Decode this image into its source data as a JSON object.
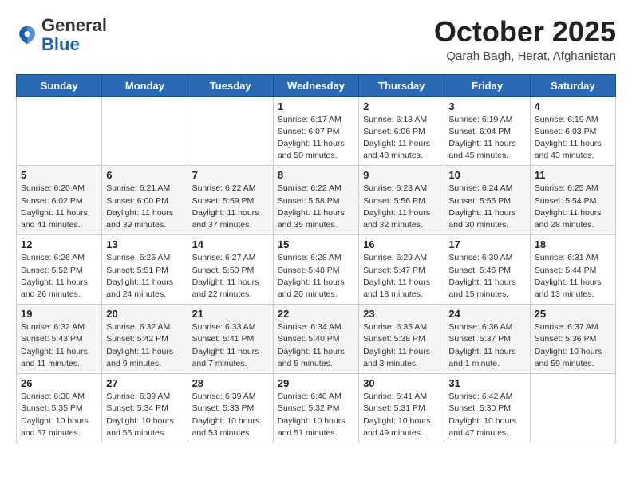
{
  "header": {
    "logo_line1": "General",
    "logo_line2": "Blue",
    "month_year": "October 2025",
    "location": "Qarah Bagh, Herat, Afghanistan"
  },
  "weekdays": [
    "Sunday",
    "Monday",
    "Tuesday",
    "Wednesday",
    "Thursday",
    "Friday",
    "Saturday"
  ],
  "weeks": [
    [
      {
        "day": "",
        "info": ""
      },
      {
        "day": "",
        "info": ""
      },
      {
        "day": "",
        "info": ""
      },
      {
        "day": "1",
        "info": "Sunrise: 6:17 AM\nSunset: 6:07 PM\nDaylight: 11 hours\nand 50 minutes."
      },
      {
        "day": "2",
        "info": "Sunrise: 6:18 AM\nSunset: 6:06 PM\nDaylight: 11 hours\nand 48 minutes."
      },
      {
        "day": "3",
        "info": "Sunrise: 6:19 AM\nSunset: 6:04 PM\nDaylight: 11 hours\nand 45 minutes."
      },
      {
        "day": "4",
        "info": "Sunrise: 6:19 AM\nSunset: 6:03 PM\nDaylight: 11 hours\nand 43 minutes."
      }
    ],
    [
      {
        "day": "5",
        "info": "Sunrise: 6:20 AM\nSunset: 6:02 PM\nDaylight: 11 hours\nand 41 minutes."
      },
      {
        "day": "6",
        "info": "Sunrise: 6:21 AM\nSunset: 6:00 PM\nDaylight: 11 hours\nand 39 minutes."
      },
      {
        "day": "7",
        "info": "Sunrise: 6:22 AM\nSunset: 5:59 PM\nDaylight: 11 hours\nand 37 minutes."
      },
      {
        "day": "8",
        "info": "Sunrise: 6:22 AM\nSunset: 5:58 PM\nDaylight: 11 hours\nand 35 minutes."
      },
      {
        "day": "9",
        "info": "Sunrise: 6:23 AM\nSunset: 5:56 PM\nDaylight: 11 hours\nand 32 minutes."
      },
      {
        "day": "10",
        "info": "Sunrise: 6:24 AM\nSunset: 5:55 PM\nDaylight: 11 hours\nand 30 minutes."
      },
      {
        "day": "11",
        "info": "Sunrise: 6:25 AM\nSunset: 5:54 PM\nDaylight: 11 hours\nand 28 minutes."
      }
    ],
    [
      {
        "day": "12",
        "info": "Sunrise: 6:26 AM\nSunset: 5:52 PM\nDaylight: 11 hours\nand 26 minutes."
      },
      {
        "day": "13",
        "info": "Sunrise: 6:26 AM\nSunset: 5:51 PM\nDaylight: 11 hours\nand 24 minutes."
      },
      {
        "day": "14",
        "info": "Sunrise: 6:27 AM\nSunset: 5:50 PM\nDaylight: 11 hours\nand 22 minutes."
      },
      {
        "day": "15",
        "info": "Sunrise: 6:28 AM\nSunset: 5:48 PM\nDaylight: 11 hours\nand 20 minutes."
      },
      {
        "day": "16",
        "info": "Sunrise: 6:29 AM\nSunset: 5:47 PM\nDaylight: 11 hours\nand 18 minutes."
      },
      {
        "day": "17",
        "info": "Sunrise: 6:30 AM\nSunset: 5:46 PM\nDaylight: 11 hours\nand 15 minutes."
      },
      {
        "day": "18",
        "info": "Sunrise: 6:31 AM\nSunset: 5:44 PM\nDaylight: 11 hours\nand 13 minutes."
      }
    ],
    [
      {
        "day": "19",
        "info": "Sunrise: 6:32 AM\nSunset: 5:43 PM\nDaylight: 11 hours\nand 11 minutes."
      },
      {
        "day": "20",
        "info": "Sunrise: 6:32 AM\nSunset: 5:42 PM\nDaylight: 11 hours\nand 9 minutes."
      },
      {
        "day": "21",
        "info": "Sunrise: 6:33 AM\nSunset: 5:41 PM\nDaylight: 11 hours\nand 7 minutes."
      },
      {
        "day": "22",
        "info": "Sunrise: 6:34 AM\nSunset: 5:40 PM\nDaylight: 11 hours\nand 5 minutes."
      },
      {
        "day": "23",
        "info": "Sunrise: 6:35 AM\nSunset: 5:38 PM\nDaylight: 11 hours\nand 3 minutes."
      },
      {
        "day": "24",
        "info": "Sunrise: 6:36 AM\nSunset: 5:37 PM\nDaylight: 11 hours\nand 1 minute."
      },
      {
        "day": "25",
        "info": "Sunrise: 6:37 AM\nSunset: 5:36 PM\nDaylight: 10 hours\nand 59 minutes."
      }
    ],
    [
      {
        "day": "26",
        "info": "Sunrise: 6:38 AM\nSunset: 5:35 PM\nDaylight: 10 hours\nand 57 minutes."
      },
      {
        "day": "27",
        "info": "Sunrise: 6:39 AM\nSunset: 5:34 PM\nDaylight: 10 hours\nand 55 minutes."
      },
      {
        "day": "28",
        "info": "Sunrise: 6:39 AM\nSunset: 5:33 PM\nDaylight: 10 hours\nand 53 minutes."
      },
      {
        "day": "29",
        "info": "Sunrise: 6:40 AM\nSunset: 5:32 PM\nDaylight: 10 hours\nand 51 minutes."
      },
      {
        "day": "30",
        "info": "Sunrise: 6:41 AM\nSunset: 5:31 PM\nDaylight: 10 hours\nand 49 minutes."
      },
      {
        "day": "31",
        "info": "Sunrise: 6:42 AM\nSunset: 5:30 PM\nDaylight: 10 hours\nand 47 minutes."
      },
      {
        "day": "",
        "info": ""
      }
    ]
  ]
}
